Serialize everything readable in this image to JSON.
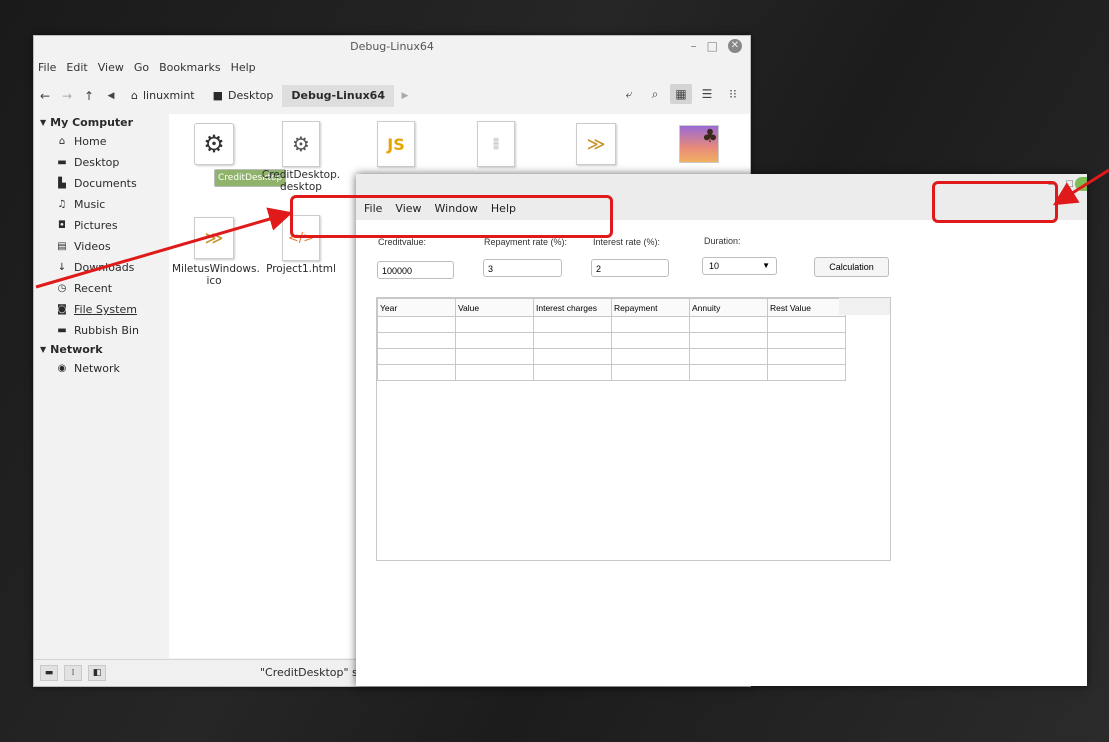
{
  "file_manager": {
    "title": "Debug-Linux64",
    "menu": [
      "File",
      "Edit",
      "View",
      "Go",
      "Bookmarks",
      "Help"
    ],
    "breadcrumbs": [
      {
        "label": "linuxmint",
        "icon": "home-icon"
      },
      {
        "label": "Desktop",
        "icon": "folder-icon"
      },
      {
        "label": "Debug-Linux64",
        "icon": ""
      }
    ],
    "sidebar": {
      "my_computer": {
        "header": "My Computer",
        "items": [
          {
            "label": "Home",
            "icon": "home-icon"
          },
          {
            "label": "Desktop",
            "icon": "desktop-icon"
          },
          {
            "label": "Documents",
            "icon": "documents-icon"
          },
          {
            "label": "Music",
            "icon": "music-icon"
          },
          {
            "label": "Pictures",
            "icon": "pictures-icon"
          },
          {
            "label": "Videos",
            "icon": "videos-icon"
          },
          {
            "label": "Downloads",
            "icon": "downloads-icon"
          },
          {
            "label": "Recent",
            "icon": "recent-icon"
          },
          {
            "label": "File System",
            "icon": "filesystem-icon"
          },
          {
            "label": "Rubbish Bin",
            "icon": "trash-icon"
          }
        ]
      },
      "network": {
        "header": "Network",
        "items": [
          {
            "label": "Network",
            "icon": "network-icon"
          }
        ]
      }
    },
    "files": [
      {
        "name": "CreditDesktop",
        "icon": "gear-icon",
        "selected": true
      },
      {
        "name": "CreditDesktop.\ndesktop",
        "icon": "gear-icon",
        "selected": false
      },
      {
        "name": "",
        "icon": "js-file-icon",
        "thumb_text": "JS",
        "selected": false
      },
      {
        "name": "",
        "icon": "text-file-icon",
        "selected": false
      },
      {
        "name": "",
        "icon": "swoosh-image-icon",
        "selected": false
      },
      {
        "name": "",
        "icon": "palm-image-icon",
        "selected": false
      },
      {
        "name": "MiletusWindows.\nico",
        "icon": "swoosh-image-icon",
        "selected": false
      },
      {
        "name": "Project1.html",
        "icon": "html-file-icon",
        "thumb_text": "</>",
        "selected": false
      }
    ],
    "status": "\"CreditDesktop\" selec"
  },
  "app": {
    "menu": [
      "File",
      "View",
      "Window",
      "Help"
    ],
    "fields": {
      "credit_label": "Creditvalue:",
      "credit_value": "100000",
      "repayment_label": "Repayment rate (%):",
      "repayment_value": "3",
      "interest_label": "Interest rate (%):",
      "interest_value": "2",
      "duration_label": "Duration:",
      "duration_value": "10"
    },
    "calc_button": "Calculation",
    "table": {
      "columns": [
        "Year",
        "Value",
        "Interest charges",
        "Repayment",
        "Annuity",
        "Rest Value"
      ],
      "row_count": 4
    }
  },
  "annotations": {
    "color": "#e01a1a"
  }
}
